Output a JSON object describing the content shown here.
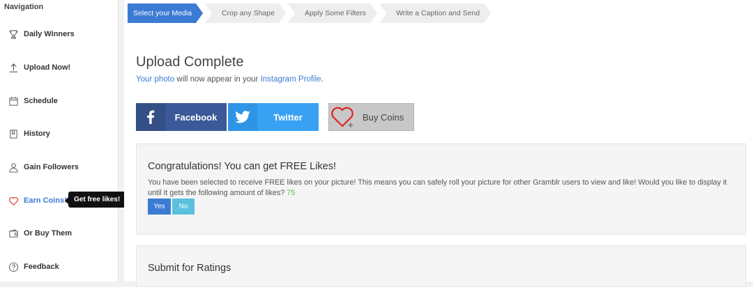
{
  "sidebar": {
    "title": "Navigation",
    "items": [
      {
        "label": "Daily Winners",
        "icon": "trophy-icon"
      },
      {
        "label": "Upload Now!",
        "icon": "upload-icon"
      },
      {
        "label": "Schedule",
        "icon": "calendar-icon"
      },
      {
        "label": "History",
        "icon": "book-icon"
      },
      {
        "label": "Gain Followers",
        "icon": "user-icon"
      },
      {
        "label": "Earn Coins!",
        "icon": "heart-icon",
        "active": true
      },
      {
        "label": "Or Buy Them",
        "icon": "wallet-icon"
      },
      {
        "label": "Feedback",
        "icon": "help-icon"
      }
    ],
    "tooltip": "Get free likes!"
  },
  "steps": [
    {
      "label": "Select your Media",
      "active": true
    },
    {
      "label": "Crop any Shape"
    },
    {
      "label": "Apply Some Filters"
    },
    {
      "label": "Write a Caption and Send"
    }
  ],
  "main": {
    "title": "Upload Complete",
    "sub_link1": "Your photo",
    "sub_mid": " will now appear in your ",
    "sub_link2": "Instagram Profile",
    "sub_end": "."
  },
  "share": {
    "facebook": "Facebook",
    "twitter": "Twitter",
    "buy": "Buy Coins"
  },
  "offer": {
    "title": "Congratulations! You can get FREE Likes!",
    "text": "You have been selected to receive FREE likes on your picture! This means you can safely roll your picture for other Gramblr users to view and like! Would you like to display it until it gets the following amount of likes? ",
    "amount": "75",
    "yes": "Yes",
    "no": "No"
  },
  "ratings": {
    "title": "Submit for Ratings"
  },
  "colors": {
    "accent": "#3b7bd4",
    "facebook": "#3b5998",
    "twitter": "#38a1f3",
    "green": "#5cb85c"
  }
}
